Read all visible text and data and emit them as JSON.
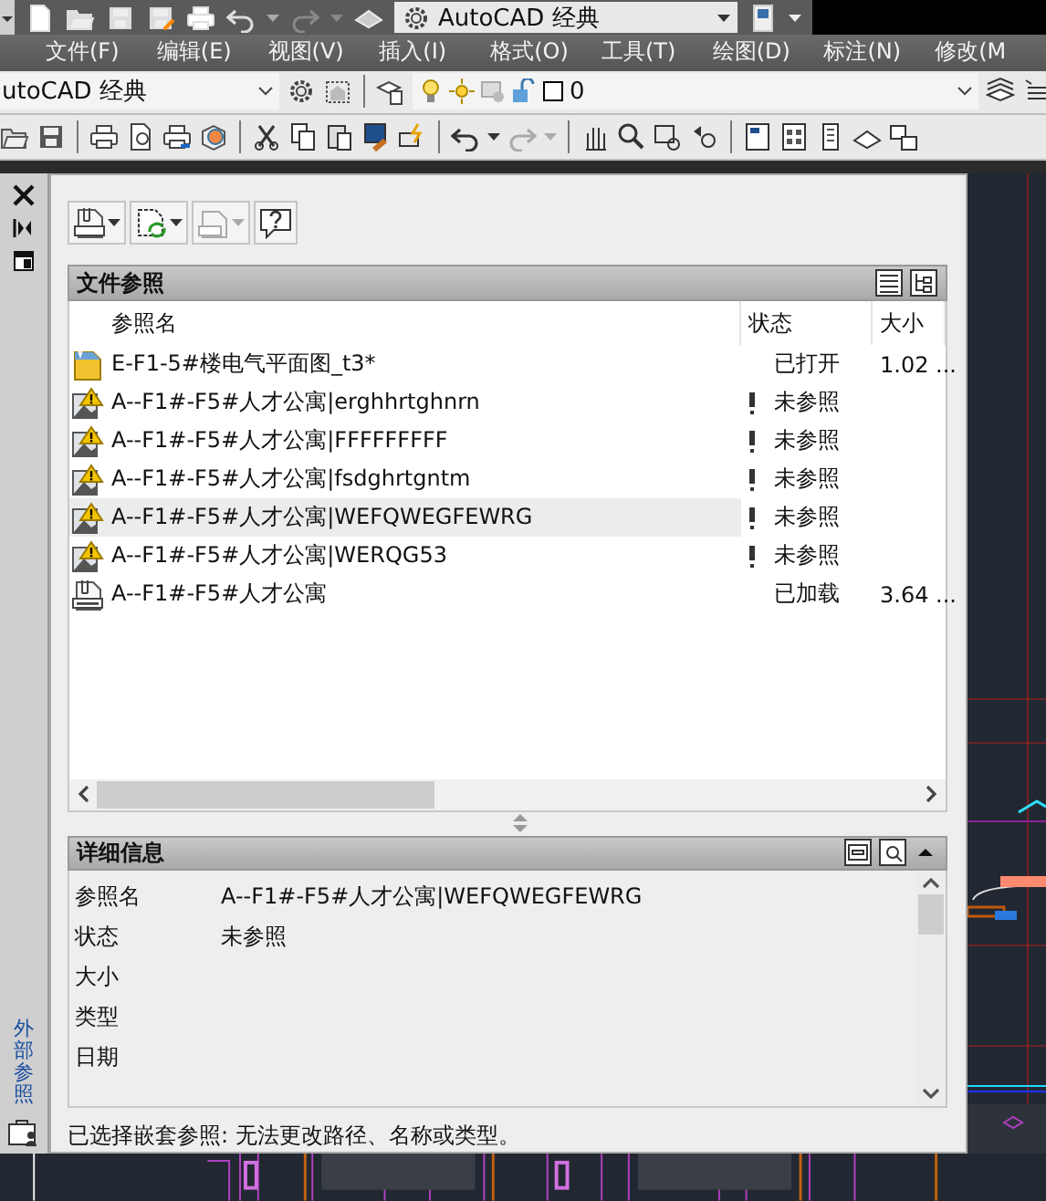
{
  "quick_access": {
    "workspace": "AutoCAD 经典"
  },
  "menu_bar": [
    "文件(F)",
    "编辑(E)",
    "视图(V)",
    "插入(I)",
    "格式(O)",
    "工具(T)",
    "绘图(D)",
    "标注(N)",
    "修改(M"
  ],
  "toolbar": {
    "workspace": "utoCAD 经典",
    "layer": "0"
  },
  "palette": {
    "title": "外部参照",
    "file_references": {
      "title": "文件参照",
      "columns": [
        "参照名",
        "状态",
        "大小"
      ],
      "rows": [
        {
          "kind": "current",
          "name": "E-F1-5#楼电气平面图_t3*",
          "status": "已打开",
          "size": "1.02 ...",
          "warning": false,
          "selected": false
        },
        {
          "kind": "nested",
          "name": "A--F1#-F5#人才公寓|erghhrtghnrn",
          "status": "未参照",
          "warning": true,
          "selected": false
        },
        {
          "kind": "nested",
          "name": "A--F1#-F5#人才公寓|FFFFFFFFF",
          "status": "未参照",
          "warning": true,
          "selected": false
        },
        {
          "kind": "nested",
          "name": "A--F1#-F5#人才公寓|fsdghrtgntm",
          "status": "未参照",
          "warning": true,
          "selected": false
        },
        {
          "kind": "nested",
          "name": "A--F1#-F5#人才公寓|WEFQWEGFEWRG",
          "status": "未参照",
          "warning": true,
          "selected": true
        },
        {
          "kind": "nested",
          "name": "A--F1#-F5#人才公寓|WERQG53",
          "status": "未参照",
          "warning": true,
          "selected": false
        },
        {
          "kind": "dwg",
          "name": "A--F1#-F5#人才公寓",
          "status": "已加载",
          "size": "3.64 ...",
          "warning": false,
          "selected": false
        }
      ]
    },
    "details": {
      "title": "详细信息",
      "rows": [
        {
          "label": "参照名",
          "value": "A--F1#-F5#人才公寓|WEFQWEGFEWRG"
        },
        {
          "label": "状态",
          "value": "未参照"
        },
        {
          "label": "大小"
        },
        {
          "label": "类型"
        },
        {
          "label": "日期"
        }
      ]
    },
    "message": "已选择嵌套参照: 无法更改路径、名称或类型。"
  }
}
